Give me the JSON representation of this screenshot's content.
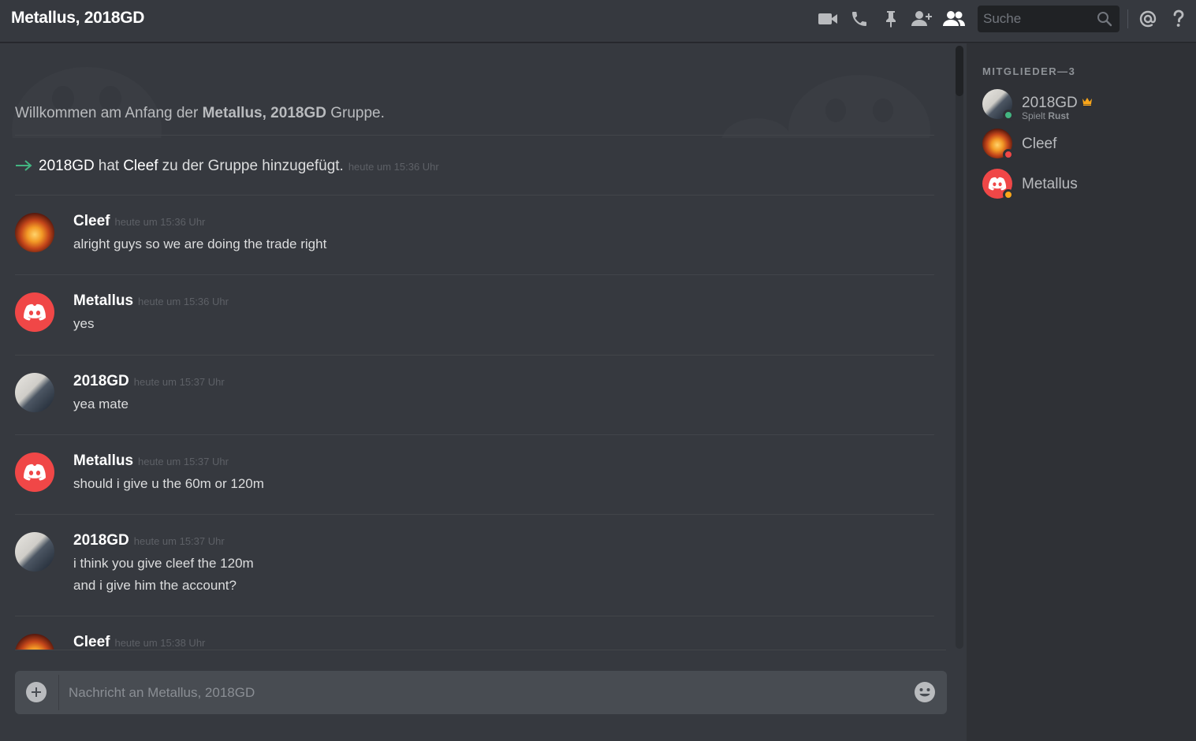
{
  "header": {
    "title": "Metallus, 2018GD",
    "search_placeholder": "Suche",
    "icons": [
      "video-call-icon",
      "voice-call-icon",
      "pin-icon",
      "add-friend-icon",
      "member-list-icon",
      "mention-icon",
      "help-icon"
    ]
  },
  "welcome": {
    "prefix": "Willkommen am Anfang der",
    "group": "Metallus, 2018GD",
    "suffix": "Gruppe."
  },
  "system_message": {
    "actor": "2018GD",
    "hat": "hat",
    "target": "Cleef",
    "action": "zu der Gruppe hinzugefügt.",
    "time": "heute um 15:36 Uhr"
  },
  "messages": [
    {
      "author": "Cleef",
      "time": "heute um 15:36 Uhr",
      "lines": [
        "alright guys so we are doing the trade right"
      ]
    },
    {
      "author": "Metallus",
      "time": "heute um 15:36 Uhr",
      "lines": [
        "yes"
      ]
    },
    {
      "author": "2018GD",
      "time": "heute um 15:37 Uhr",
      "lines": [
        "yea mate"
      ]
    },
    {
      "author": "Metallus",
      "time": "heute um 15:37 Uhr",
      "lines": [
        "should i give u the 60m or 120m"
      ]
    },
    {
      "author": "2018GD",
      "time": "heute um 15:37 Uhr",
      "lines": [
        "i think you give cleef the 120m",
        "and i give him the account?"
      ]
    },
    {
      "author": "Cleef",
      "time": "heute um 15:38 Uhr",
      "lines": []
    }
  ],
  "composer": {
    "placeholder": "Nachricht an Metallus, 2018GD"
  },
  "members": {
    "header": "MITGLIEDER—3",
    "list": [
      {
        "name": "2018GD",
        "activity_prefix": "Spielt",
        "activity_game": "Rust",
        "status": "online",
        "status_color": "#43b581",
        "owner": true
      },
      {
        "name": "Cleef",
        "status": "dnd",
        "status_color": "#f04747"
      },
      {
        "name": "Metallus",
        "status": "idle",
        "status_color": "#faa61a"
      }
    ]
  },
  "colors": {
    "background": "#36393f",
    "sidebar": "#2f3136",
    "accent_green": "#43b581",
    "discord_red": "#f04747",
    "crown": "#faa61a"
  }
}
